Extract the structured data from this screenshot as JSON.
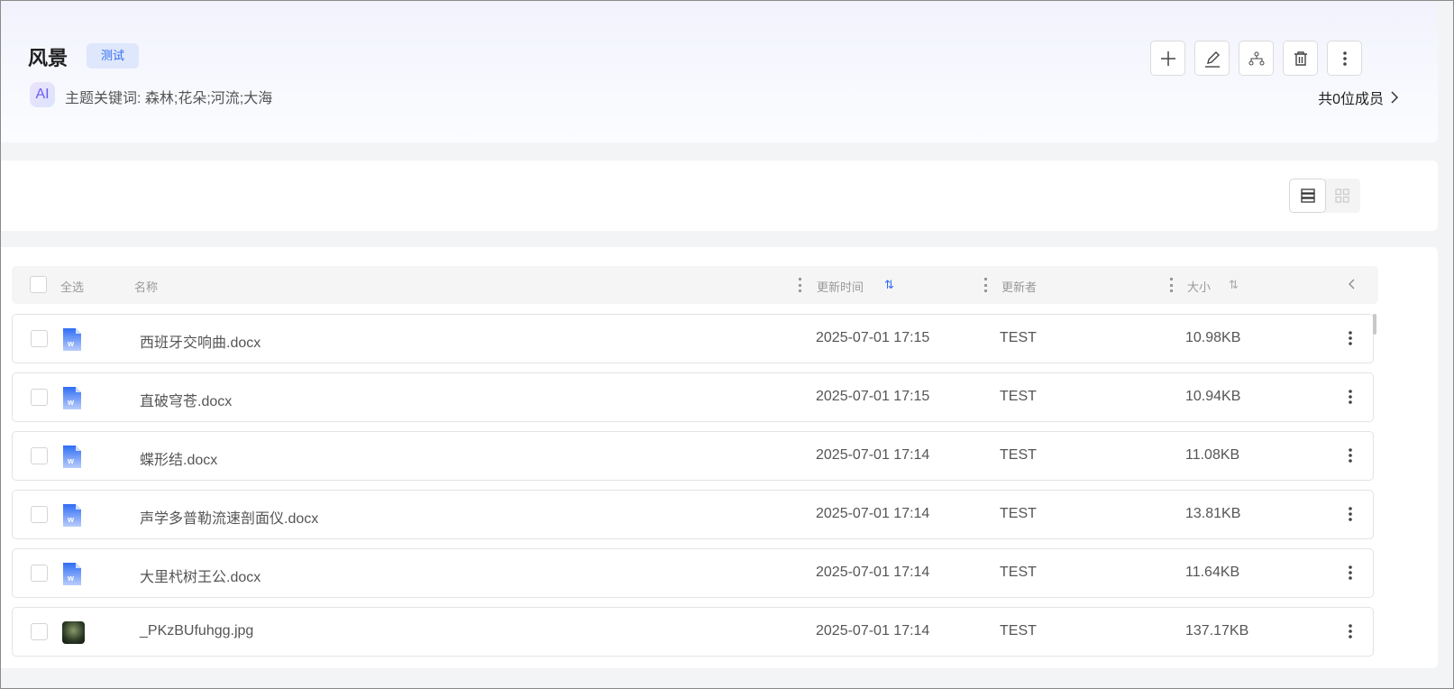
{
  "header": {
    "title": "风景",
    "tag": "测试",
    "ai_badge": "AI",
    "keywords": "主题关键词: 森林;花朵;河流;大海",
    "members": "共0位成员",
    "actions": [
      "plus-icon",
      "edit-icon",
      "share-structure-icon",
      "trash-icon",
      "more-icon"
    ]
  },
  "table": {
    "select_all": "全选",
    "columns": {
      "name": "名称",
      "updated": "更新时间",
      "updater": "更新者",
      "size": "大小"
    },
    "rows": [
      {
        "name": "西班牙交响曲.docx",
        "time": "2025-07-01 17:15",
        "by": "TEST",
        "size": "10.98KB",
        "type": "docx"
      },
      {
        "name": "直破穹苍.docx",
        "time": "2025-07-01 17:15",
        "by": "TEST",
        "size": "10.94KB",
        "type": "docx"
      },
      {
        "name": "蝶形结.docx",
        "time": "2025-07-01 17:14",
        "by": "TEST",
        "size": "11.08KB",
        "type": "docx"
      },
      {
        "name": "声学多普勒流速剖面仪.docx",
        "time": "2025-07-01 17:14",
        "by": "TEST",
        "size": "13.81KB",
        "type": "docx"
      },
      {
        "name": "大里杙树王公.docx",
        "time": "2025-07-01 17:14",
        "by": "TEST",
        "size": "11.64KB",
        "type": "docx"
      },
      {
        "name": "_PKzBUfuhgg.jpg",
        "time": "2025-07-01 17:14",
        "by": "TEST",
        "size": "137.17KB",
        "type": "jpg"
      }
    ]
  },
  "colors": {
    "accent": "#2f6df4",
    "tag_bg": "#dfe7fc"
  }
}
